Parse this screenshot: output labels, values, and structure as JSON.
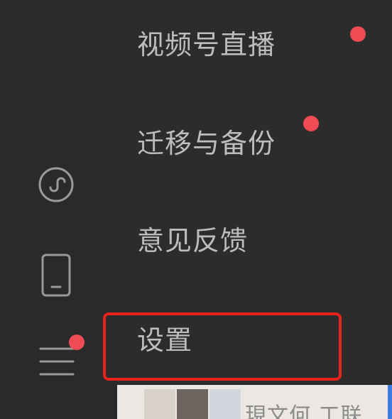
{
  "menu": {
    "items": [
      {
        "label": "视频号直播",
        "has_dot": true
      },
      {
        "label": "迁移与备份",
        "has_dot": true
      },
      {
        "label": "意见反馈",
        "has_dot": false
      },
      {
        "label": "设置",
        "has_dot": false,
        "highlighted": true
      }
    ]
  },
  "sidebar": {
    "icons": [
      {
        "name": "mini-program-icon"
      },
      {
        "name": "phone-icon"
      },
      {
        "name": "menu-icon",
        "has_dot": true
      }
    ]
  },
  "bottom": {
    "snippet": "現文何 工联"
  },
  "colors": {
    "background": "#2b2b2b",
    "text": "#bdbdbd",
    "badge": "#f04b54",
    "highlight": "#e8231d"
  }
}
